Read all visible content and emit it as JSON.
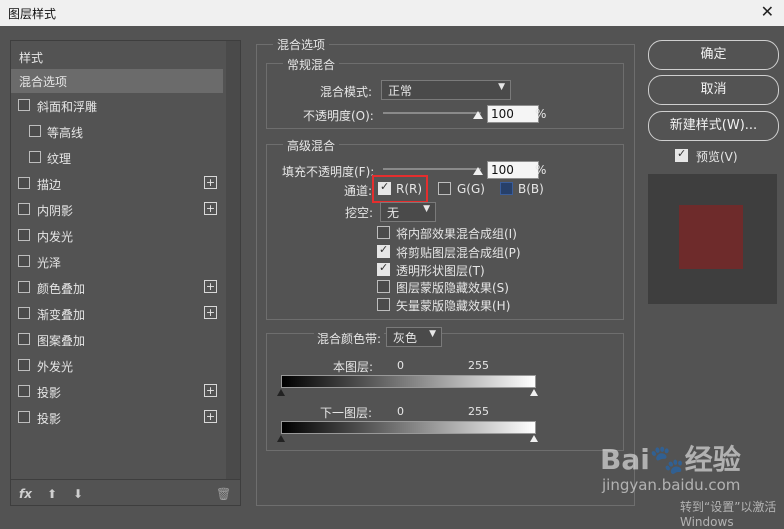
{
  "window": {
    "title": "图层样式",
    "close_glyph": "✕"
  },
  "left": {
    "header": "样式",
    "items": [
      {
        "label": "混合选项",
        "selected": true
      },
      {
        "label": "斜面和浮雕"
      },
      {
        "label": "等高线"
      },
      {
        "label": "纹理"
      },
      {
        "label": "描边"
      },
      {
        "label": "内阴影"
      },
      {
        "label": "内发光"
      },
      {
        "label": "光泽"
      },
      {
        "label": "颜色叠加"
      },
      {
        "label": "渐变叠加"
      },
      {
        "label": "图案叠加"
      },
      {
        "label": "外发光"
      },
      {
        "label": "投影"
      },
      {
        "label": "投影"
      }
    ],
    "plus_glyph": "+",
    "footer": {
      "fx": "fx",
      "up": "⬆",
      "down": "⬇",
      "trash": "🗑"
    }
  },
  "blend": {
    "title": "混合选项",
    "normal": {
      "title": "常规混合",
      "mode_label": "混合模式:",
      "mode_value": "正常",
      "opacity_label": "不透明度(O):",
      "opacity_value": "100",
      "opacity_unit": "%"
    },
    "advanced": {
      "title": "高级混合",
      "fill_label": "填充不透明度(F):",
      "fill_value": "100",
      "fill_unit": "%",
      "channel_label": "通道:",
      "channels": [
        {
          "label": "R(R)",
          "checked": true
        },
        {
          "label": "G(G)",
          "checked": false
        },
        {
          "label": "B(B)",
          "checked": false
        }
      ],
      "knockout_label": "挖空:",
      "knockout_value": "无",
      "options": [
        {
          "label": "将内部效果混合成组(I)",
          "checked": false
        },
        {
          "label": "将剪贴图层混合成组(P)",
          "checked": true
        },
        {
          "label": "透明形状图层(T)",
          "checked": true
        },
        {
          "label": "图层蒙版隐藏效果(S)",
          "checked": false
        },
        {
          "label": "矢量蒙版隐藏效果(H)",
          "checked": false
        }
      ]
    },
    "blend_if": {
      "label": "混合颜色带:",
      "value": "灰色",
      "this_layer": "本图层:",
      "under_layer": "下一图层:",
      "min": "0",
      "max": "255"
    }
  },
  "right": {
    "ok": "确定",
    "cancel": "取消",
    "new_style": "新建样式(W)...",
    "preview_label": "预览(V)",
    "preview_checked": true,
    "preview_color": "#6e2b2b"
  },
  "watermark": {
    "brand": "Bai🐾经验",
    "url": "jingyan.baidu.com",
    "sub": "转到“设置”以激活 Windows"
  },
  "colors": {
    "bg": "#535353",
    "selected": "#6b6b6b",
    "highlight": "#e52e2e"
  }
}
